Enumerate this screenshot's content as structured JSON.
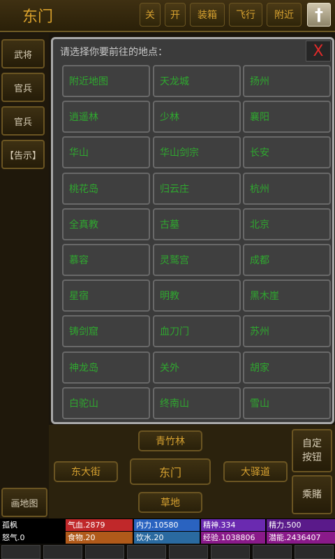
{
  "header": {
    "location": "东门",
    "buttons": [
      "关",
      "开",
      "装箱",
      "飞行",
      "附近"
    ],
    "cross_icon": "dagger-icon"
  },
  "left": {
    "items": [
      "武将",
      "官兵",
      "官兵",
      "【告示】"
    ],
    "map_button": "画地图"
  },
  "dialog": {
    "prompt": "请选择你要前往的地点：",
    "close_label": "X",
    "places": [
      "附近地图",
      "天龙城",
      "扬州",
      "逍遥林",
      "少林",
      "襄阳",
      "华山",
      "华山剑宗",
      "长安",
      "桃花岛",
      "归云庄",
      "杭州",
      "全真教",
      "古墓",
      "北京",
      "慕容",
      "灵鹫宫",
      "成都",
      "星宿",
      "明教",
      "黑木崖",
      "铸剑窟",
      "血刀门",
      "苏州",
      "神龙岛",
      "关外",
      "胡家",
      "白驼山",
      "终南山",
      "雪山"
    ]
  },
  "map": {
    "north": "青竹林",
    "west": "东大街",
    "center": "东门",
    "east": "大驿道",
    "south": "草地",
    "custom_button": "自定\n按钮",
    "gamble_button": "乘賭"
  },
  "status": {
    "name": "孤枫",
    "qixue": "气血.2879",
    "neili": "内力.10580",
    "jingshen": "精神.334",
    "jingli": "精力.500",
    "nuqi": "怒气.0",
    "shiwu": "食物.20",
    "yinshui": "饮水.20",
    "jingyan": "经验.1038806",
    "qianneng": "潜能.2436407"
  },
  "colors": {
    "accent": "#d6a130",
    "place_text": "#2fa82f",
    "close": "#e22a2a",
    "hp": "#c0282a",
    "mp": "#2a63c0",
    "spirit": "#6a2ab0",
    "food": "#b05a1a",
    "water": "#2a6aa0",
    "exp": "#8a1a8a",
    "potential": "#8a1a8a"
  }
}
